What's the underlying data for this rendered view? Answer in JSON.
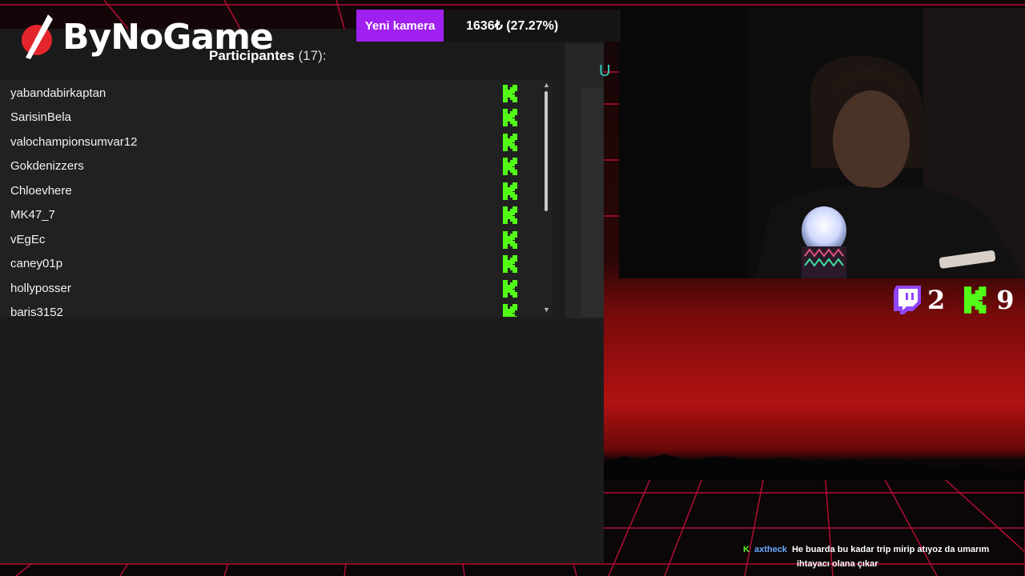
{
  "brand": {
    "name": "ByNoGame"
  },
  "topbar": {
    "camera_button": "Yeni kamera",
    "funding": "1636₺ (27.27%)"
  },
  "participants": {
    "title": "Participantes",
    "count": "(17):",
    "items": [
      {
        "name": "yabandabirkaptan",
        "platform": "kick"
      },
      {
        "name": "SarisinBela",
        "platform": "kick"
      },
      {
        "name": "valochampionsumvar12",
        "platform": "kick"
      },
      {
        "name": "Gokdenizzers",
        "platform": "kick"
      },
      {
        "name": "Chloevhere",
        "platform": "kick"
      },
      {
        "name": "MK47_7",
        "platform": "kick"
      },
      {
        "name": "vEgEc",
        "platform": "kick"
      },
      {
        "name": "caney01p",
        "platform": "kick"
      },
      {
        "name": "hollyposser",
        "platform": "kick"
      },
      {
        "name": "baris3152",
        "platform": "kick"
      }
    ]
  },
  "side_panel": {
    "char": "U"
  },
  "platform_counts": {
    "twitch": "2",
    "kick": "9"
  },
  "chat": {
    "user": "axtheck",
    "message_line1": "He buarda bu kadar trip mirip atıyoz da umarım",
    "message_line2": "ihtayacı olana çıkar"
  },
  "colors": {
    "kick_green": "#53fc18",
    "twitch_purple": "#9146ff",
    "camera_button": "#a020f0",
    "panel_bg": "#1c1c1c"
  }
}
